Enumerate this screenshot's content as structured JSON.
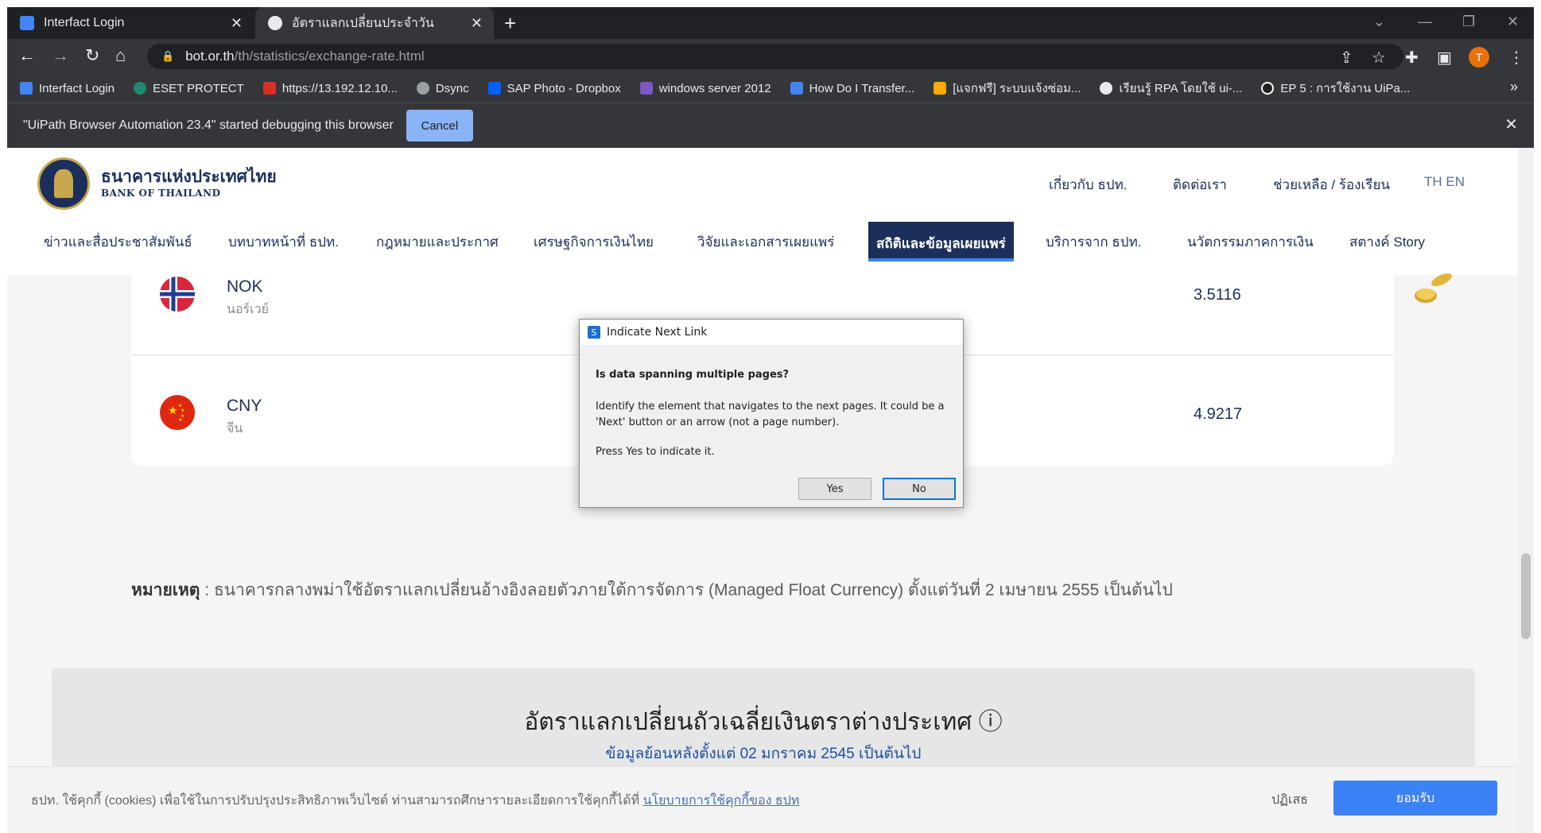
{
  "browser": {
    "tabs": [
      {
        "title": "Interfact Login",
        "icon": "monitor-icon"
      },
      {
        "title": "อัตราแลกเปลี่ยนประจำวัน",
        "icon": "bot-favicon"
      }
    ],
    "url_host": "bot.or.th",
    "url_path": "/th/statistics/exchange-rate.html",
    "profile_initial": "T",
    "bookmarks": [
      {
        "label": "Interfact Login",
        "color": "#4285f4"
      },
      {
        "label": "ESET PROTECT",
        "color": "#1f8a70"
      },
      {
        "label": "https://13.192.12.10...",
        "color": "#d93025"
      },
      {
        "label": "Dsync",
        "color": "#9aa0a6"
      },
      {
        "label": "SAP Photo - Dropbox",
        "color": "#0061ff"
      },
      {
        "label": "windows server 2012",
        "color": "#7e57c2"
      },
      {
        "label": "How Do I Transfer...",
        "color": "#4285f4"
      },
      {
        "label": "[แจกฟรี] ระบบแจ้งซ่อม...",
        "color": "#f9ab00"
      },
      {
        "label": "เรียนรู้ RPA โดยใช้ ui-...",
        "color": "#e8eaed"
      },
      {
        "label": "EP 5 : การใช้งาน UiPa...",
        "color": "#202124"
      }
    ],
    "more_bookmarks": "»",
    "infobar_text": "\"UiPath Browser Automation 23.4\" started debugging this browser",
    "infobar_cancel": "Cancel"
  },
  "site": {
    "brand_th": "ธนาคารแห่งประเทศไทย",
    "brand_en": "BANK OF THAILAND",
    "top_links": [
      "เกี่ยวกับ ธปท.",
      "ติดต่อเรา",
      "ช่วยเหลือ / ร้องเรียน"
    ],
    "lang_th": "TH",
    "lang_en": "EN",
    "nav": [
      "ข่าวและสื่อประชาสัมพันธ์",
      "บทบาทหน้าที่ ธปท.",
      "กฎหมายและประกาศ",
      "เศรษฐกิจการเงินไทย",
      "วิจัยและเอกสารเผยแพร่",
      "สถิติและข้อมูลเผยแพร่",
      "บริการจาก ธปท.",
      "นวัตกรรมภาคการเงิน",
      "สตางค์ Story"
    ],
    "active_nav_index": 5
  },
  "rates": [
    {
      "code": "NOK",
      "name": "นอร์เวย์",
      "rate": "3.5116",
      "flag": "norway-flag-icon"
    },
    {
      "code": "CNY",
      "name": "จีน",
      "rate": "4.9217",
      "flag": "china-flag-icon"
    }
  ],
  "note": {
    "label": "หมายเหตุ",
    "text": " : ธนาคารกลางพม่าใช้อัตราแลกเปลี่ยนอ้างอิงลอยตัวภายใต้การจัดการ (Managed Float Currency) ตั้งแต่วันที่ 2 เมษายน 2555 เป็นต้นไป"
  },
  "average_panel": {
    "title": "อัตราแลกเปลี่ยนถัวเฉลี่ยเงินตราต่างประเทศ",
    "info_icon": "ⓘ",
    "subtitle": "ข้อมูลย้อนหลังตั้งแต่ 02 มกราคม 2545 เป็นต้นไป"
  },
  "cookie": {
    "text": "ธปท. ใช้คุกกี้ (cookies) เพื่อใช้ในการปรับปรุงประสิทธิภาพเว็บไซต์ ท่านสามารถศึกษารายละเอียดการใช้คุกกี้ได้ที่ ",
    "link": "นโยบายการใช้คุกกี้ของ ธปท",
    "reject": "ปฏิเสธ",
    "accept": "ยอมรับ"
  },
  "dialog": {
    "title": "Indicate Next Link",
    "question": "Is data spanning multiple pages?",
    "body": "Identify the element that navigates to the next pages. It could be a 'Next' button or an arrow (not a page number).",
    "press": "Press Yes to indicate it.",
    "yes": "Yes",
    "no": "No"
  },
  "colors": {
    "bot_navy": "#1c2f5a",
    "accent_blue": "#3b82f6",
    "chrome_dark": "#202124"
  }
}
